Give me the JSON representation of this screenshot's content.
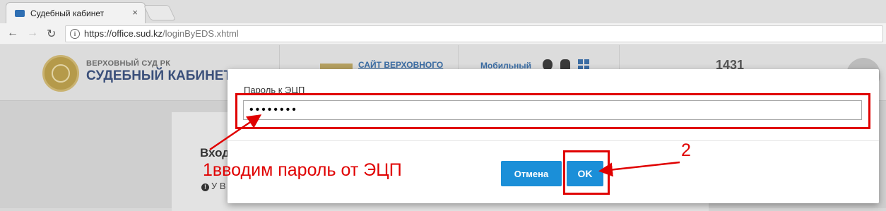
{
  "browser": {
    "tab_title": "Судебный кабинет",
    "tab_close": "×",
    "url_host": "https://office.sud.kz",
    "url_path": "/loginByEDS.xhtml",
    "nav": {
      "back": "←",
      "forward": "→",
      "reload": "↻"
    }
  },
  "header": {
    "brand_sub": "ВЕРХОВНЫЙ СУД РК",
    "brand_main": "СУДЕБНЫЙ КАБИНЕТ",
    "site_link": "САЙТ ВЕРХОВНОГО",
    "mobile_label": "Мобильный",
    "stats_partial": "1431"
  },
  "card": {
    "title": "Вход",
    "note": "У В"
  },
  "modal": {
    "label": "Пароль к ЭЦП",
    "password_value": "••••••••",
    "cancel_label": "Отмена",
    "ok_label": "OK"
  },
  "annotations": {
    "step1": "1вводим пароль от ЭЦП",
    "step2": "2",
    "color": "#e00000"
  }
}
